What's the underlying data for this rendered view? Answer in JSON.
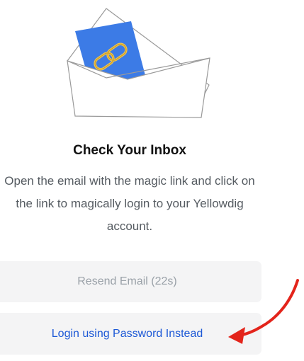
{
  "header": {
    "title": "Check Your Inbox"
  },
  "main": {
    "message": "Open the email with the magic link and click on the link to magically login to your Yellowdig account."
  },
  "buttons": {
    "resend_label": "Resend Email (22s)",
    "password_label": "Login using Password Instead"
  },
  "colors": {
    "card_blue": "#3c7be6",
    "link_gold": "#f2c44a",
    "annotation_red": "#e3241b",
    "button_link": "#1c58d6"
  },
  "icons": {
    "illustration": "envelope-with-link-card-icon",
    "annotation": "red-arrow-icon"
  }
}
